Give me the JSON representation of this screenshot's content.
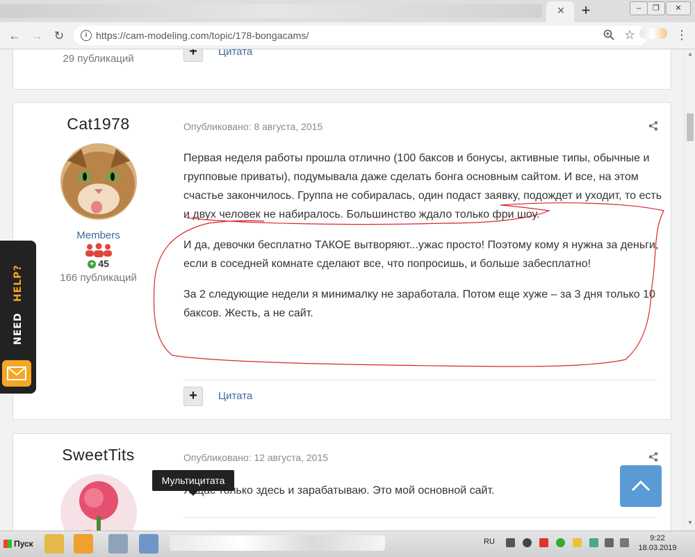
{
  "browser": {
    "url_host": "https://cam-modeling.com",
    "url_path": "/topic/178-bongacams/",
    "active_tab_close": "×",
    "new_tab": "+"
  },
  "posts": [
    {
      "post_count": "29 публикаций",
      "quote_label": "Цитата"
    },
    {
      "username": "Cat1978",
      "date": "Опубликовано: 8 августа, 2015",
      "group": "Members",
      "reputation": "45",
      "post_count": "166 публикаций",
      "paragraphs": [
        "Первая неделя работы прошла отлично (100 баксов и бонусы, активные типы, обычные и групповые приваты), подумывала даже сделать бонга основным сайтом. И все, на этом счастье закончилось. Группа не собиралась, один подаст заявку, подождет и уходит, то есть и двух человек не набиралось. Большинство ждало только фри шоу.",
        "И да, девочки бесплатно ТАКОЕ вытворяют...ужас просто! Поэтому кому я нужна за деньги, если в соседней комнате сделают все, что попросишь, и больше забесплатно!",
        "За 2 следующие недели я минималку не заработала. Потом еще хуже – за 3 дня только 10 баксов. Жесть, а не сайт."
      ],
      "quote_label": "Цитата"
    },
    {
      "username": "SweetTits",
      "date": "Опубликовано: 12 августа, 2015",
      "text": "Я щас только здесь и зарабатываю. Это мой основной сайт."
    }
  ],
  "tooltip": "Мультицитата",
  "need_help": {
    "need": "NEED",
    "help": "HELP?"
  },
  "taskbar": {
    "start_label": "Пуск",
    "language": "RU",
    "time": "9:22",
    "date": "18.03.2019"
  },
  "colors": {
    "link": "#3a6a9b",
    "to_top": "#5b9bd5",
    "annotation": "#d9252c"
  }
}
